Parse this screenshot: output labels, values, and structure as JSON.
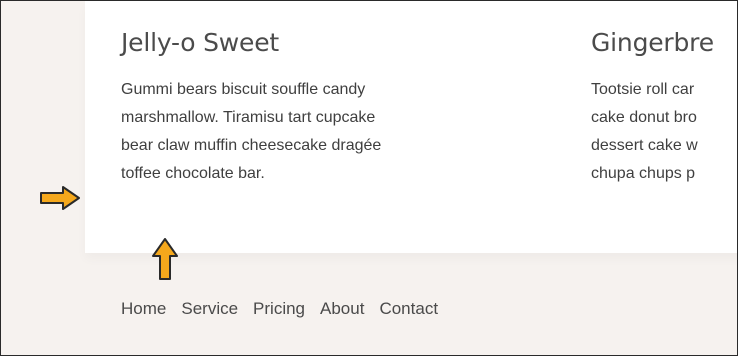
{
  "cards": [
    {
      "title": "Jelly-o Sweet",
      "text": "Gummi bears biscuit souffle candy\nmarshmallow. Tiramisu tart cupcake\nbear claw muffin cheesecake dragée\ntoffee chocolate bar."
    },
    {
      "title": "Gingerbre",
      "text": "Tootsie roll car\ncake donut bro\ndessert cake w\nchupa chups p"
    }
  ],
  "footer_nav": {
    "items": [
      "Home",
      "Service",
      "Pricing",
      "About",
      "Contact"
    ]
  },
  "annotations": {
    "arrow_color": "#f5a81c",
    "arrow_outline": "#2a2a2a",
    "right_arrow_icon": "arrow-right-icon",
    "up_arrow_icon": "arrow-up-icon"
  }
}
